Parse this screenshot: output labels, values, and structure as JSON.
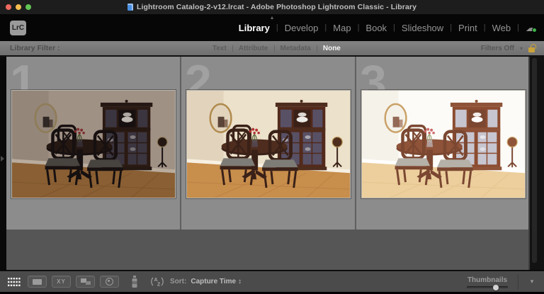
{
  "window": {
    "title": "Lightroom Catalog-2-v12.lrcat - Adobe Photoshop Lightroom Classic - Library"
  },
  "app": {
    "badge": "LrC"
  },
  "modules": {
    "separator": "|",
    "items": [
      {
        "label": "Library",
        "active": true
      },
      {
        "label": "Develop",
        "active": false
      },
      {
        "label": "Map",
        "active": false
      },
      {
        "label": "Book",
        "active": false
      },
      {
        "label": "Slideshow",
        "active": false
      },
      {
        "label": "Print",
        "active": false
      },
      {
        "label": "Web",
        "active": false
      }
    ],
    "sync_icon": "cloud-sync-ok"
  },
  "filter_bar": {
    "label": "Library Filter :",
    "options": [
      "Text",
      "Attribute",
      "Metadata",
      "None"
    ],
    "active_option": "None",
    "filters_status": "Filters Off",
    "lock_icon": "padlock-open"
  },
  "grid": {
    "cells": [
      {
        "index": "1",
        "exposure": "underexposed dining-room photo"
      },
      {
        "index": "2",
        "exposure": "normal-exposure dining-room photo"
      },
      {
        "index": "3",
        "exposure": "overexposed dining-room photo"
      }
    ]
  },
  "toolbar": {
    "views": [
      "grid-view",
      "loupe-view",
      "compare-view",
      "survey-view",
      "people-view"
    ],
    "compare_glyph": "XY",
    "sort_glyph_top": "A",
    "sort_glyph_bottom": "Z",
    "sort_label": "Sort:",
    "sort_value": "Capture Time",
    "thumbnails_label": "Thumbnails"
  },
  "colors": {
    "active_module": "#ffffff",
    "cell_background": "#8c8c8c",
    "cell_index_number": "#a1a1a1",
    "lock_gold": "#c9a23a",
    "sync_green": "#3cb54a",
    "traffic_red": "#ee6a5f",
    "traffic_yellow": "#f5bd4f",
    "traffic_green": "#61c554"
  }
}
